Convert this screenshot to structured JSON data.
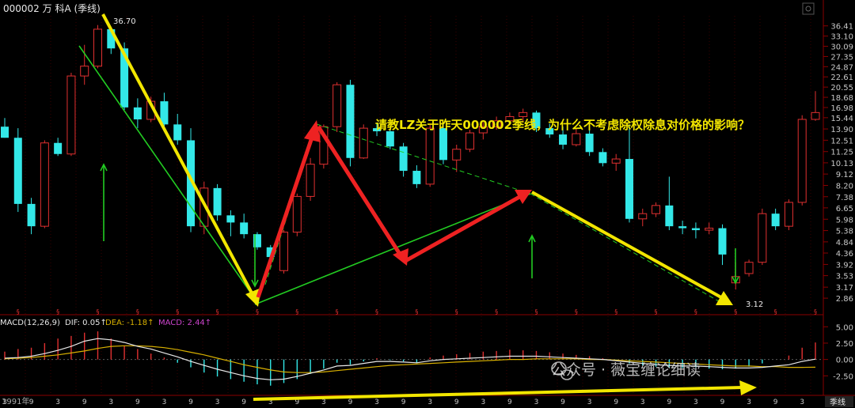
{
  "header": {
    "title": "000002 万 科A (季线)"
  },
  "question_text": "请教LZ关于昨天000002季线，为什么不考虑除权除息对价格的影响？",
  "macd_header": {
    "name": "MACD(12,26,9)",
    "dif": "DIF: 0.05↑",
    "dea": "DEA: -1.18↑",
    "macd": "MACD: 2.44↑"
  },
  "watermark": "公众号 · 薇宝缠论细读",
  "period_button": "季线",
  "year_label": "1991年",
  "colors": {
    "up": "#e03030",
    "down": "#33e8e8",
    "yellow_arrow": "#f2e600",
    "red_arrow": "#ee2222",
    "green_line": "#22cc22",
    "dif": "#e8e8e8",
    "dea": "#d8b000",
    "macd": "#cc44cc",
    "grid": "#550000"
  },
  "chart_data": {
    "type": "candlestick",
    "title": "000002 万 科A (季线)",
    "y_scale": "log",
    "ylim": [
      2.6,
      40
    ],
    "y_ticks": [
      "36.41",
      "33.10",
      "30.09",
      "27.35",
      "24.87",
      "22.61",
      "20.55",
      "18.68",
      "16.98",
      "15.44",
      "13.90",
      "12.51",
      "11.25",
      "10.13",
      "9.12",
      "8.20",
      "7.38",
      "6.65",
      "5.98",
      "5.38",
      "4.84",
      "4.36",
      "3.92",
      "3.53",
      "3.17",
      "2.86"
    ],
    "annotations": {
      "high_label": "36.70",
      "low_label": "3.12"
    },
    "candles": [
      {
        "o": 14.2,
        "h": 15.4,
        "l": 12.8,
        "c": 12.8
      },
      {
        "o": 12.8,
        "h": 14.0,
        "l": 6.4,
        "c": 6.9
      },
      {
        "o": 6.9,
        "h": 7.3,
        "l": 5.2,
        "c": 5.6
      },
      {
        "o": 5.6,
        "h": 12.5,
        "l": 5.5,
        "c": 12.2
      },
      {
        "o": 12.2,
        "h": 12.8,
        "l": 10.8,
        "c": 11.0
      },
      {
        "o": 11.0,
        "h": 23.5,
        "l": 10.8,
        "c": 22.8
      },
      {
        "o": 22.8,
        "h": 30.5,
        "l": 21.0,
        "c": 25.0
      },
      {
        "o": 25.0,
        "h": 36.7,
        "l": 24.5,
        "c": 35.3
      },
      {
        "o": 35.3,
        "h": 36.0,
        "l": 28.0,
        "c": 29.5
      },
      {
        "o": 29.5,
        "h": 31.2,
        "l": 16.6,
        "c": 17.0
      },
      {
        "o": 17.0,
        "h": 18.5,
        "l": 14.0,
        "c": 15.2
      },
      {
        "o": 15.2,
        "h": 18.8,
        "l": 14.8,
        "c": 18.0
      },
      {
        "o": 18.0,
        "h": 19.5,
        "l": 14.2,
        "c": 14.5
      },
      {
        "o": 14.5,
        "h": 16.0,
        "l": 12.0,
        "c": 12.5
      },
      {
        "o": 12.5,
        "h": 14.0,
        "l": 5.3,
        "c": 5.6
      },
      {
        "o": 5.6,
        "h": 8.5,
        "l": 5.2,
        "c": 8.0
      },
      {
        "o": 8.0,
        "h": 8.3,
        "l": 5.9,
        "c": 6.2
      },
      {
        "o": 6.2,
        "h": 6.5,
        "l": 5.1,
        "c": 5.8
      },
      {
        "o": 5.8,
        "h": 6.3,
        "l": 5.0,
        "c": 5.2
      },
      {
        "o": 5.2,
        "h": 5.3,
        "l": 4.5,
        "c": 4.6
      },
      {
        "o": 4.6,
        "h": 4.7,
        "l": 3.8,
        "c": 4.2
      },
      {
        "o": 3.7,
        "h": 5.4,
        "l": 3.6,
        "c": 5.3
      },
      {
        "o": 5.3,
        "h": 7.6,
        "l": 5.1,
        "c": 7.4
      },
      {
        "o": 7.4,
        "h": 10.6,
        "l": 7.1,
        "c": 10.0
      },
      {
        "o": 10.0,
        "h": 14.5,
        "l": 9.6,
        "c": 14.2
      },
      {
        "o": 14.2,
        "h": 21.5,
        "l": 13.5,
        "c": 21.0
      },
      {
        "o": 21.0,
        "h": 22.0,
        "l": 9.8,
        "c": 10.6
      },
      {
        "o": 10.6,
        "h": 14.5,
        "l": 10.5,
        "c": 14.0
      },
      {
        "o": 14.0,
        "h": 14.6,
        "l": 13.0,
        "c": 13.6
      },
      {
        "o": 13.6,
        "h": 14.0,
        "l": 11.5,
        "c": 11.8
      },
      {
        "o": 11.8,
        "h": 12.2,
        "l": 8.9,
        "c": 9.4
      },
      {
        "o": 9.4,
        "h": 9.9,
        "l": 8.0,
        "c": 8.3
      },
      {
        "o": 8.3,
        "h": 14.5,
        "l": 8.1,
        "c": 14.0
      },
      {
        "o": 14.0,
        "h": 14.6,
        "l": 10.0,
        "c": 10.4
      },
      {
        "o": 10.4,
        "h": 12.0,
        "l": 9.3,
        "c": 11.5
      },
      {
        "o": 11.5,
        "h": 13.8,
        "l": 11.2,
        "c": 13.4
      },
      {
        "o": 13.4,
        "h": 14.8,
        "l": 12.6,
        "c": 14.2
      },
      {
        "o": 14.2,
        "h": 15.6,
        "l": 13.8,
        "c": 15.0
      },
      {
        "o": 15.0,
        "h": 16.2,
        "l": 14.4,
        "c": 15.6
      },
      {
        "o": 15.6,
        "h": 16.8,
        "l": 14.8,
        "c": 16.2
      },
      {
        "o": 16.2,
        "h": 16.5,
        "l": 13.5,
        "c": 14.0
      },
      {
        "o": 14.0,
        "h": 14.6,
        "l": 12.8,
        "c": 13.2
      },
      {
        "o": 13.2,
        "h": 14.2,
        "l": 11.5,
        "c": 12.0
      },
      {
        "o": 12.0,
        "h": 14.0,
        "l": 11.8,
        "c": 13.3
      },
      {
        "o": 13.3,
        "h": 13.8,
        "l": 10.8,
        "c": 11.2
      },
      {
        "o": 11.2,
        "h": 11.6,
        "l": 9.8,
        "c": 10.1
      },
      {
        "o": 10.1,
        "h": 11.0,
        "l": 9.4,
        "c": 10.5
      },
      {
        "o": 10.5,
        "h": 14.5,
        "l": 5.8,
        "c": 6.0
      },
      {
        "o": 6.0,
        "h": 6.6,
        "l": 5.6,
        "c": 6.3
      },
      {
        "o": 6.3,
        "h": 7.0,
        "l": 6.1,
        "c": 6.8
      },
      {
        "o": 6.8,
        "h": 8.9,
        "l": 5.4,
        "c": 5.6
      },
      {
        "o": 5.6,
        "h": 5.9,
        "l": 5.2,
        "c": 5.5
      },
      {
        "o": 5.5,
        "h": 5.8,
        "l": 5.0,
        "c": 5.4
      },
      {
        "o": 5.4,
        "h": 5.8,
        "l": 5.2,
        "c": 5.5
      },
      {
        "o": 5.5,
        "h": 5.7,
        "l": 3.9,
        "c": 4.3
      },
      {
        "o": 3.3,
        "h": 4.0,
        "l": 3.1,
        "c": 3.5
      },
      {
        "o": 3.6,
        "h": 4.1,
        "l": 3.5,
        "c": 4.0
      },
      {
        "o": 4.0,
        "h": 6.6,
        "l": 3.9,
        "c": 6.3
      },
      {
        "o": 6.3,
        "h": 6.6,
        "l": 5.4,
        "c": 5.6
      },
      {
        "o": 5.6,
        "h": 7.2,
        "l": 5.4,
        "c": 7.0
      },
      {
        "o": 7.0,
        "h": 15.8,
        "l": 6.8,
        "c": 15.2
      },
      {
        "o": 15.2,
        "h": 19.8,
        "l": 15.0,
        "c": 16.2
      }
    ],
    "macd": {
      "ylim": [
        -5,
        6
      ],
      "y_ticks": [
        "5.00",
        "2.50",
        "0.00",
        "-2.50"
      ],
      "hist": [
        1.2,
        1.6,
        1.8,
        2.5,
        3.2,
        3.6,
        4.1,
        4.3,
        3.2,
        2.1,
        1.6,
        0.9,
        0.3,
        -0.5,
        -1.2,
        -2.0,
        -2.6,
        -3.0,
        -3.4,
        -3.8,
        -4.0,
        -3.6,
        -3.0,
        -2.2,
        -1.4,
        -0.5,
        -0.8,
        -0.3,
        0.2,
        -0.1,
        -0.3,
        -0.5,
        0.3,
        0.6,
        0.8,
        1.0,
        1.2,
        1.3,
        1.5,
        1.4,
        1.3,
        1.1,
        0.9,
        0.7,
        0.5,
        0.2,
        -0.2,
        -0.6,
        -0.9,
        -1.1,
        -1.2,
        -1.3,
        -1.2,
        -1.4,
        -1.5,
        -1.4,
        -1.1,
        -0.6,
        0.0,
        0.6,
        1.8,
        2.6
      ],
      "dif": [
        0.2,
        0.3,
        0.5,
        0.9,
        1.4,
        2.0,
        2.8,
        3.2,
        3.0,
        2.6,
        2.0,
        1.6,
        1.0,
        0.4,
        -0.3,
        -0.9,
        -1.5,
        -2.0,
        -2.5,
        -2.9,
        -3.1,
        -3.0,
        -2.6,
        -2.1,
        -1.6,
        -1.0,
        -0.9,
        -0.6,
        -0.3,
        -0.3,
        -0.4,
        -0.5,
        -0.2,
        0.0,
        0.1,
        0.2,
        0.3,
        0.4,
        0.5,
        0.5,
        0.5,
        0.4,
        0.3,
        0.2,
        0.1,
        0.0,
        -0.2,
        -0.4,
        -0.6,
        -0.8,
        -0.9,
        -1.0,
        -1.0,
        -1.1,
        -1.2,
        -1.3,
        -1.3,
        -1.2,
        -1.0,
        -0.8,
        -0.3,
        0.05
      ],
      "dea": [
        0.1,
        0.2,
        0.3,
        0.5,
        0.7,
        1.0,
        1.3,
        1.7,
        2.0,
        2.1,
        2.1,
        2.0,
        1.8,
        1.5,
        1.1,
        0.7,
        0.2,
        -0.3,
        -0.8,
        -1.2,
        -1.6,
        -1.9,
        -2.0,
        -2.0,
        -1.9,
        -1.7,
        -1.5,
        -1.3,
        -1.1,
        -0.9,
        -0.8,
        -0.7,
        -0.6,
        -0.5,
        -0.4,
        -0.3,
        -0.2,
        -0.1,
        0.0,
        0.0,
        0.1,
        0.1,
        0.1,
        0.1,
        0.0,
        0.0,
        -0.1,
        -0.2,
        -0.3,
        -0.4,
        -0.5,
        -0.6,
        -0.7,
        -0.8,
        -0.9,
        -1.0,
        -1.0,
        -1.1,
        -1.1,
        -1.2,
        -1.2,
        -1.18
      ]
    }
  }
}
